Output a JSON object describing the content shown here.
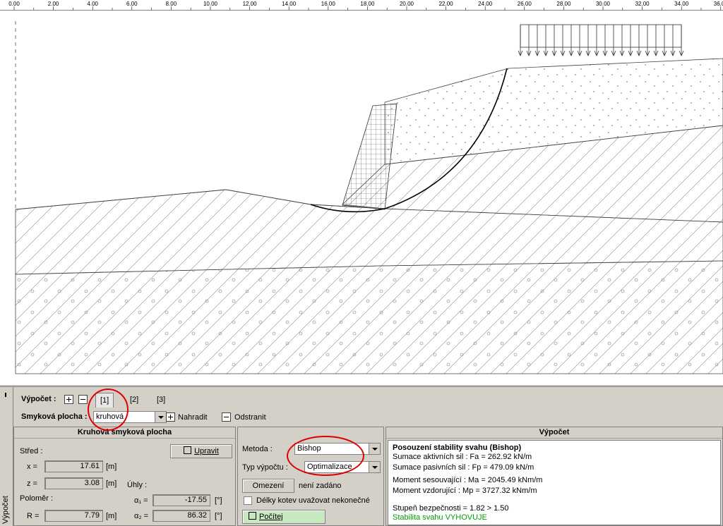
{
  "ruler": {
    "ticks": [
      "0.00",
      "2.00",
      "4.00",
      "6.00",
      "8.00",
      "10.00",
      "12.00",
      "14.00",
      "16.00",
      "18.00",
      "20.00",
      "22.00",
      "24.00",
      "26.00",
      "28.00",
      "30.00",
      "32.00",
      "34.00",
      "36.00"
    ]
  },
  "side_tab": {
    "label": "Výpočet"
  },
  "calc_bar": {
    "label": "Výpočet :",
    "tabs": [
      "[1]",
      "[2]",
      "[3]"
    ]
  },
  "slip_bar": {
    "label": "Smyková plocha :",
    "type_value": "kruhová",
    "replace_label": "Nahradit",
    "remove_label": "Odstranit"
  },
  "circle_panel": {
    "title": "Kruhová smyková plocha",
    "edit_label": "Upravit",
    "center_label": "Střed :",
    "x_label": "x =",
    "x_value": "17.61",
    "z_label": "z =",
    "z_value": "3.08",
    "unit_m": "[m]",
    "radius_label": "Poloměr :",
    "r_label": "R =",
    "r_value": "7.79",
    "angles_label": "Úhly :",
    "a1_label": "α₁ =",
    "a1_value": "-17.55",
    "a2_label": "α₂ =",
    "a2_value": "86.32",
    "unit_deg": "[°]"
  },
  "method_panel": {
    "method_label": "Metoda :",
    "method_value": "Bishop",
    "calc_type_label": "Typ výpočtu :",
    "calc_type_value": "Optimalizace",
    "limits_label": "Omezení",
    "limits_status": "není zadáno",
    "anchors_label": "Délky kotev uvažovat nekonečné",
    "compute_label": "Počítej"
  },
  "result_panel": {
    "title": "Výpočet",
    "heading": "Posouzení stability svahu (Bishop)",
    "lines": [
      "Sumace aktivních sil :  Fa =    262.92  kN/m",
      "Sumace pasivních sil :  Fp =    479.09  kN/m",
      "Moment sesouvající :   Ma = 2045.49  kNm/m",
      "Moment vzdorující :    Mp = 3727.32  kNm/m"
    ],
    "safety": "Stupeň bezpečnosti = 1.82 > 1.50",
    "verdict": "Stabilita svahu VYHOVUJE",
    "verdict_color": "#00a000"
  },
  "colors": {
    "annotation": "#e00000",
    "compute_button": "#c8e8c0"
  }
}
